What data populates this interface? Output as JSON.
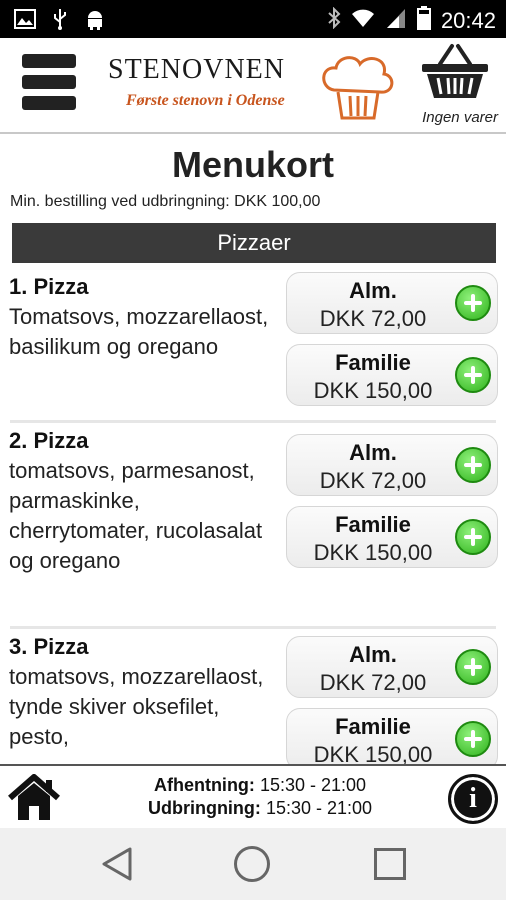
{
  "status": {
    "time": "20:42",
    "icons": [
      "image-icon",
      "usb-icon",
      "android-icon",
      "bluetooth-icon",
      "wifi-icon",
      "signal-icon",
      "battery-icon"
    ]
  },
  "header": {
    "brand": "STENOVNEN",
    "tagline": "Første stenovn i Odense",
    "cart_label": "Ingen varer"
  },
  "page": {
    "title": "Menukort",
    "min_order": "Min. bestilling ved udbringning: DKK 100,00",
    "category": "Pizzaer"
  },
  "items": [
    {
      "name": "1. Pizza",
      "description": "Tomatsovs, mozzarellaost, basilikum og oregano",
      "prices": [
        {
          "size": "Alm.",
          "price": "DKK 72,00"
        },
        {
          "size": "Familie",
          "price": "DKK 150,00"
        }
      ]
    },
    {
      "name": "2. Pizza",
      "description": "tomatsovs, parmesanost, parmaskinke, cherrytomater, rucolasalat og oregano",
      "prices": [
        {
          "size": "Alm.",
          "price": "DKK 72,00"
        },
        {
          "size": "Familie",
          "price": "DKK 150,00"
        }
      ]
    },
    {
      "name": "3. Pizza",
      "description": "tomatsovs, mozzarellaost, tynde skiver oksefilet, pesto,",
      "prices": [
        {
          "size": "Alm.",
          "price": "DKK 72,00"
        },
        {
          "size": "Familie",
          "price": "DKK 150,00"
        }
      ]
    }
  ],
  "footer": {
    "pickup_label": "Afhentning:",
    "pickup_hours": "15:30 - 21:00",
    "delivery_label": "Udbringning:",
    "delivery_hours": "15:30 - 21:00"
  },
  "colors": {
    "category_bar": "#3a3a3a",
    "add_button": "#2fb31c",
    "tagline": "#c8551e"
  }
}
